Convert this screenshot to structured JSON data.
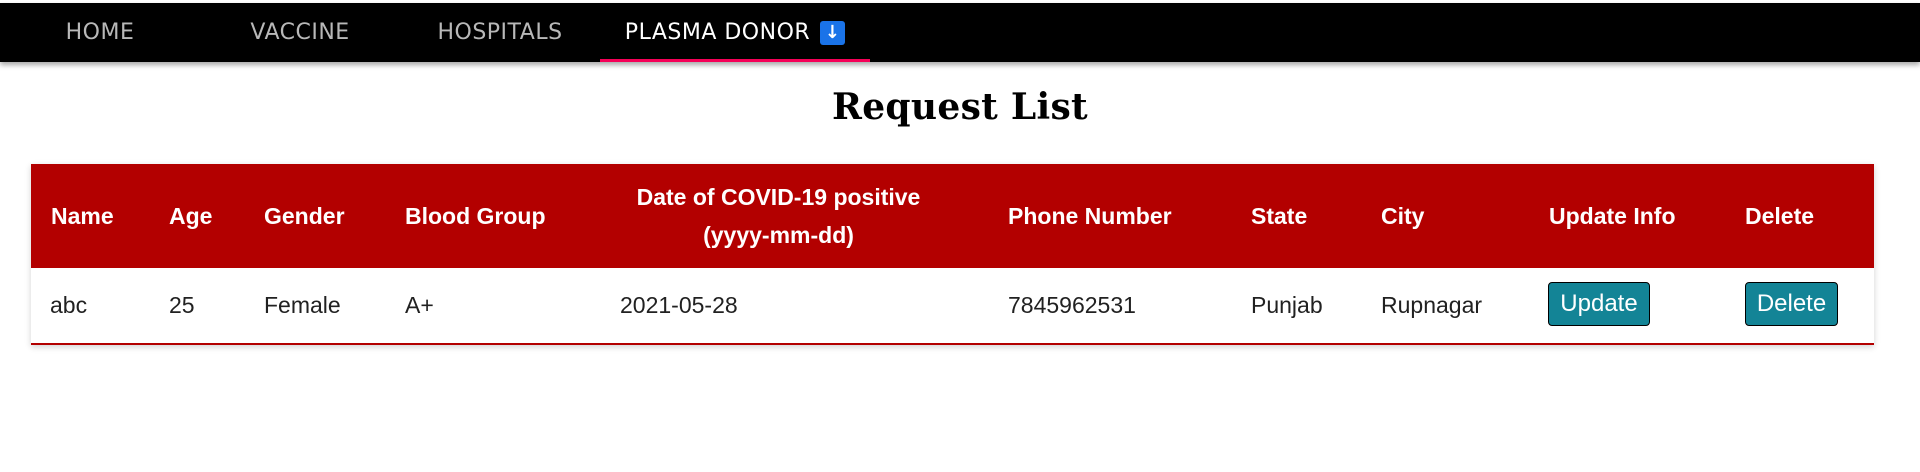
{
  "nav": {
    "tabs": [
      {
        "label": "HOME"
      },
      {
        "label": "VACCINE"
      },
      {
        "label": "HOSPITALS"
      },
      {
        "label": "PLASMA DONOR"
      }
    ],
    "active_tab": "PLASMA DONOR",
    "dropdown_icon": "down-arrow-icon",
    "accent_color": "#f50057",
    "icon_color": "#1a73e8"
  },
  "page": {
    "title": "Request List"
  },
  "table": {
    "header_color": "#b30000",
    "columns": {
      "name": "Name",
      "age": "Age",
      "gender": "Gender",
      "blood_group": "Blood Group",
      "date_line1": "Date of COVID-19 positive",
      "date_line2": "(yyyy-mm-dd)",
      "phone": "Phone Number",
      "state": "State",
      "city": "City",
      "update_info": "Update Info",
      "delete": "Delete"
    },
    "rows": [
      {
        "name": "abc",
        "age": "25",
        "gender": "Female",
        "blood_group": "A+",
        "date": "2021-05-28",
        "phone": "7845962531",
        "state": "Punjab",
        "city": "Rupnagar",
        "update_label": "Update",
        "delete_label": "Delete"
      }
    ],
    "button_color": "#138496"
  }
}
